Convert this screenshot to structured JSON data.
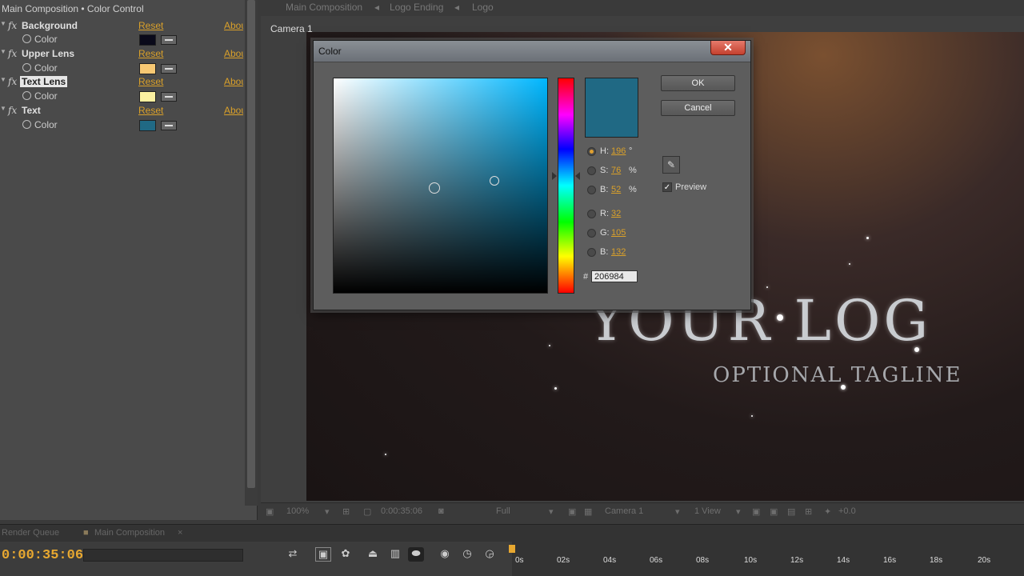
{
  "effects_panel": {
    "header": "Main Composition • Color Control",
    "effects": [
      {
        "name": "Background",
        "reset": "Reset",
        "about": "About...",
        "prop": "Color",
        "swatch": "#0a0a1a",
        "selected": false
      },
      {
        "name": "Upper Lens",
        "reset": "Reset",
        "about": "About...",
        "prop": "Color",
        "swatch": "#f7c873",
        "selected": false
      },
      {
        "name": "Text Lens",
        "reset": "Reset",
        "about": "About...",
        "prop": "Color",
        "swatch": "#fbf0a0",
        "selected": true
      },
      {
        "name": "Text",
        "reset": "Reset",
        "about": "About...",
        "prop": "Color",
        "swatch": "#206984",
        "selected": false
      }
    ]
  },
  "comp_tabs": [
    "Main Composition",
    "Logo Ending",
    "Logo"
  ],
  "viewer": {
    "camera_label": "Camera 1",
    "logo_text": "YOUR LOG",
    "tagline": "OPTIONAL TAGLINE",
    "toolbar": {
      "zoom": "100%",
      "timecode": "0:00:35:06",
      "resolution": "Full",
      "camera": "Camera 1",
      "view": "1 View",
      "exposure": "+0.0"
    }
  },
  "timeline": {
    "tabs": [
      "Render Queue",
      "Main Composition"
    ],
    "timecode": "0:00:35:06",
    "ruler_ticks": [
      "0s",
      "02s",
      "04s",
      "06s",
      "08s",
      "10s",
      "12s",
      "14s",
      "16s",
      "18s",
      "20s"
    ]
  },
  "color_dialog": {
    "title": "Color",
    "close_symbol": "✕",
    "ok_label": "OK",
    "cancel_label": "Cancel",
    "preview_label": "Preview",
    "preview_checked": true,
    "current_color": "#206984",
    "hue_field_color": "#00b7ff",
    "fields": {
      "h": {
        "label": "H:",
        "value": "196",
        "unit": "°"
      },
      "s": {
        "label": "S:",
        "value": "76",
        "unit": "%"
      },
      "b": {
        "label": "B:",
        "value": "52",
        "unit": "%"
      },
      "r": {
        "label": "R:",
        "value": "32",
        "unit": ""
      },
      "g": {
        "label": "G:",
        "value": "105",
        "unit": ""
      },
      "b2": {
        "label": "B:",
        "value": "132",
        "unit": ""
      }
    },
    "hex_prefix": "#",
    "hex_value": "206984",
    "selected_mode": "H"
  }
}
